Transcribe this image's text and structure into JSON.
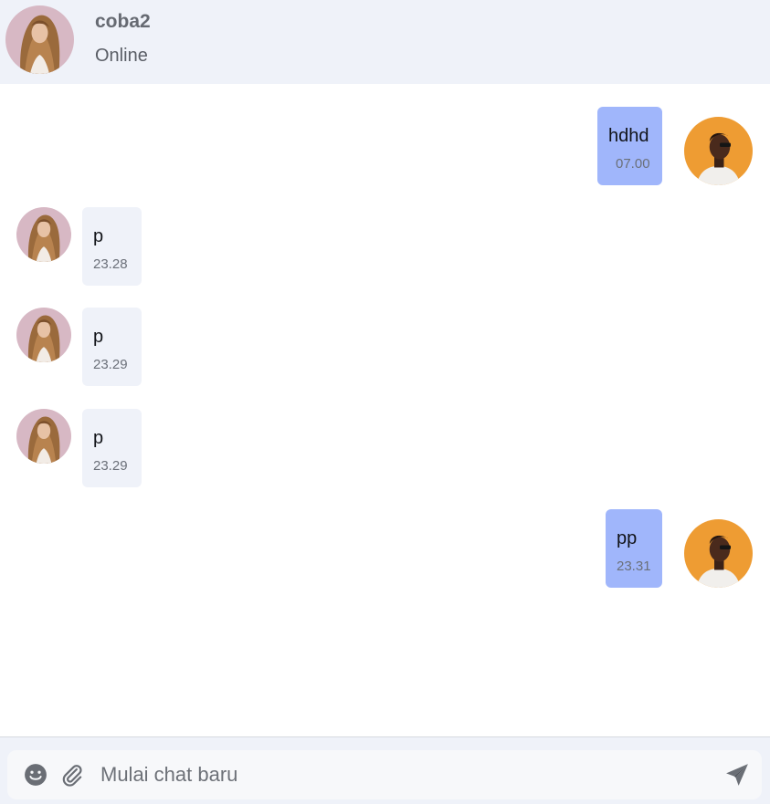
{
  "header": {
    "name": "coba2",
    "status": "Online"
  },
  "messages": [
    {
      "direction": "outgoing",
      "text": "hdhd",
      "time": "07.00"
    },
    {
      "direction": "incoming",
      "text": "p",
      "time": "23.28"
    },
    {
      "direction": "incoming",
      "text": "p",
      "time": "23.29"
    },
    {
      "direction": "incoming",
      "text": "p",
      "time": "23.29"
    },
    {
      "direction": "outgoing",
      "text": "pp",
      "time": "23.31"
    }
  ],
  "composer": {
    "placeholder": "Mulai chat baru",
    "value": "",
    "icons": [
      "emoji-icon",
      "paperclip-icon",
      "send-icon"
    ]
  },
  "colors": {
    "header_bg": "#eff2f9",
    "outgoing_bubble": "#a0b6fb",
    "incoming_bubble": "#eff2f9",
    "contact_avatar_bg": "#d7b8c4",
    "self_avatar_bg": "#ee9c33"
  }
}
